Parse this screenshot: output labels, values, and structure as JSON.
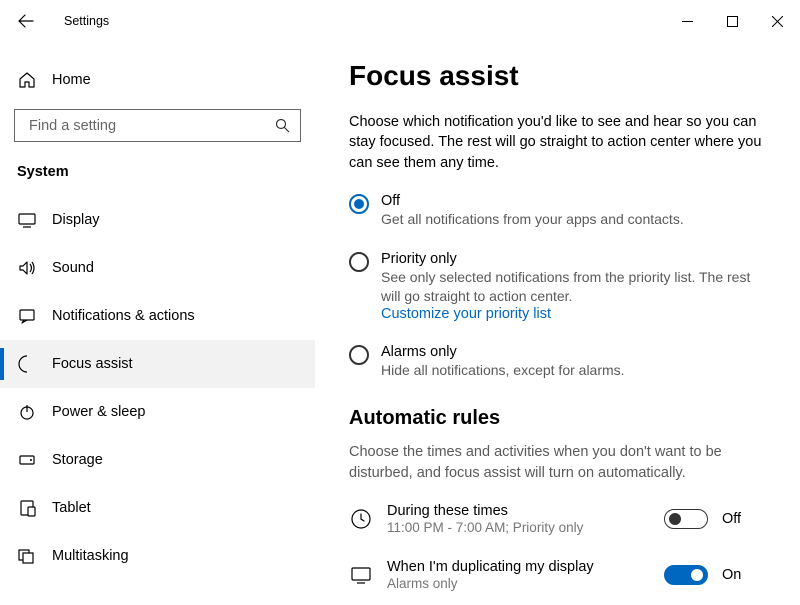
{
  "titlebar": {
    "title": "Settings"
  },
  "sidebar": {
    "home_label": "Home",
    "search_placeholder": "Find a setting",
    "category": "System",
    "items": [
      {
        "label": "Display",
        "icon": "display"
      },
      {
        "label": "Sound",
        "icon": "sound"
      },
      {
        "label": "Notifications & actions",
        "icon": "notifications"
      },
      {
        "label": "Focus assist",
        "icon": "focus",
        "selected": true
      },
      {
        "label": "Power & sleep",
        "icon": "power"
      },
      {
        "label": "Storage",
        "icon": "storage"
      },
      {
        "label": "Tablet",
        "icon": "tablet"
      },
      {
        "label": "Multitasking",
        "icon": "multitask"
      }
    ]
  },
  "main": {
    "title": "Focus assist",
    "description": "Choose which notification you'd like to see and hear so you can stay focused. The rest will go straight to action center where you can see them any time.",
    "radios": [
      {
        "label": "Off",
        "desc": "Get all notifications from your apps and contacts.",
        "selected": true
      },
      {
        "label": "Priority only",
        "desc": "See only selected notifications from the priority list. The rest will go straight to action center.",
        "link": "Customize your priority list"
      },
      {
        "label": "Alarms only",
        "desc": "Hide all notifications, except for alarms."
      }
    ],
    "rules_title": "Automatic rules",
    "rules_desc": "Choose the times and activities when you don't want to be disturbed, and focus assist will turn on automatically.",
    "rules": [
      {
        "title": "During these times",
        "sub": "11:00 PM - 7:00 AM; Priority only",
        "on": false,
        "state_label": "Off",
        "icon": "clock"
      },
      {
        "title": "When I'm duplicating my display",
        "sub": "Alarms only",
        "on": true,
        "state_label": "On",
        "icon": "display"
      }
    ]
  }
}
